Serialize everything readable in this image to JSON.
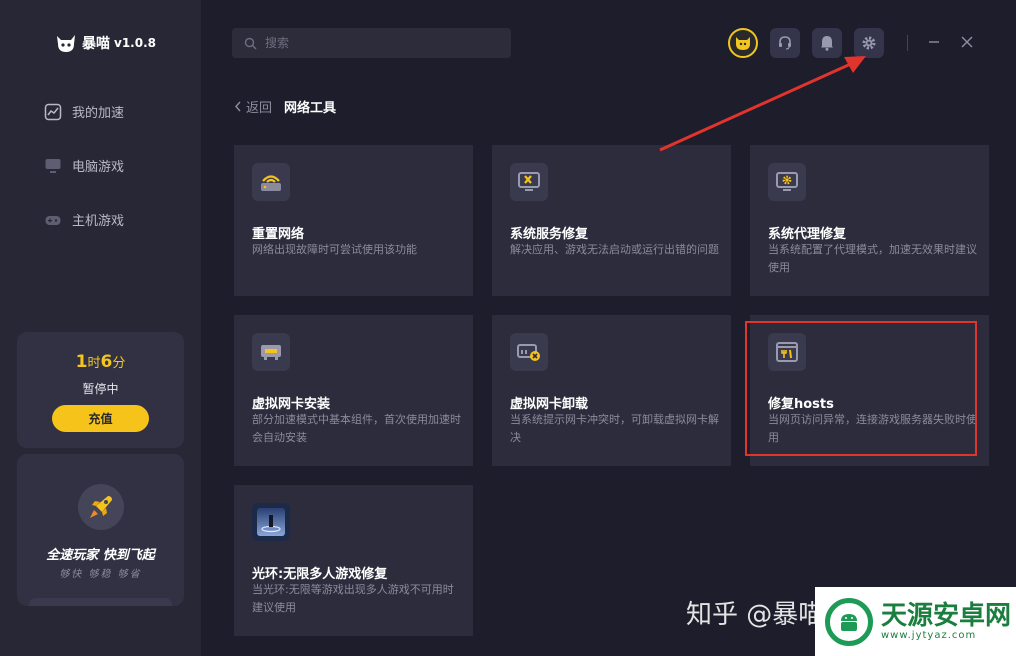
{
  "app": {
    "name": "暴喵",
    "version": "v1.0.8"
  },
  "sidebar": {
    "items": [
      {
        "label": "我的加速",
        "icon": "speed-chart-icon"
      },
      {
        "label": "电脑游戏",
        "icon": "monitor-icon"
      },
      {
        "label": "主机游戏",
        "icon": "gamepad-icon"
      }
    ],
    "time_card": {
      "hours": "1",
      "hours_unit": "时",
      "minutes": "6",
      "minutes_unit": "分",
      "status": "暂停中",
      "recharge_label": "充值"
    },
    "promo": {
      "title": "全速玩家  快到飞起",
      "tags": "够快 够稳 够省"
    }
  },
  "header": {
    "search_placeholder": "搜索",
    "buttons": [
      "avatar-icon",
      "headset-icon",
      "bell-icon",
      "gear-icon"
    ],
    "window": [
      "minimize-icon",
      "close-icon"
    ]
  },
  "breadcrumb": {
    "back": "返回",
    "title": "网络工具"
  },
  "tools": [
    {
      "title": "重置网络",
      "desc": "网络出现故障时可尝试使用该功能",
      "icon": "router-icon"
    },
    {
      "title": "系统服务修复",
      "desc": "解决应用、游戏无法启动或运行出错的问题",
      "icon": "monitor-wrench-icon"
    },
    {
      "title": "系统代理修复",
      "desc": "当系统配置了代理模式，加速无效果时建议使用",
      "icon": "monitor-gear-icon"
    },
    {
      "title": "虚拟网卡安装",
      "desc": "部分加速模式中基本组件，首次使用加速时会自动安装",
      "icon": "network-card-icon"
    },
    {
      "title": "虚拟网卡卸载",
      "desc": "当系统提示网卡冲突时，可卸载虚拟网卡解决",
      "icon": "network-card-remove-icon"
    },
    {
      "title": "修复hosts",
      "desc": "当网页访问异常，连接游戏服务器失败时使用",
      "icon": "browser-tools-icon"
    },
    {
      "title": "光环:无限多人游戏修复",
      "desc": "当光环:无限等游戏出现多人游戏不可用时建议使用",
      "icon": "halo-game-icon"
    }
  ],
  "watermark": {
    "text": "知乎 @暴喵",
    "site_name": "天源安卓网",
    "site_url": "www.jytyaz.com"
  },
  "colors": {
    "accent": "#f6c31b",
    "highlight": "#e0342c",
    "arrow": "#e0342c",
    "card_bg": "#2c2c3d",
    "sidebar_bg": "#272736"
  }
}
